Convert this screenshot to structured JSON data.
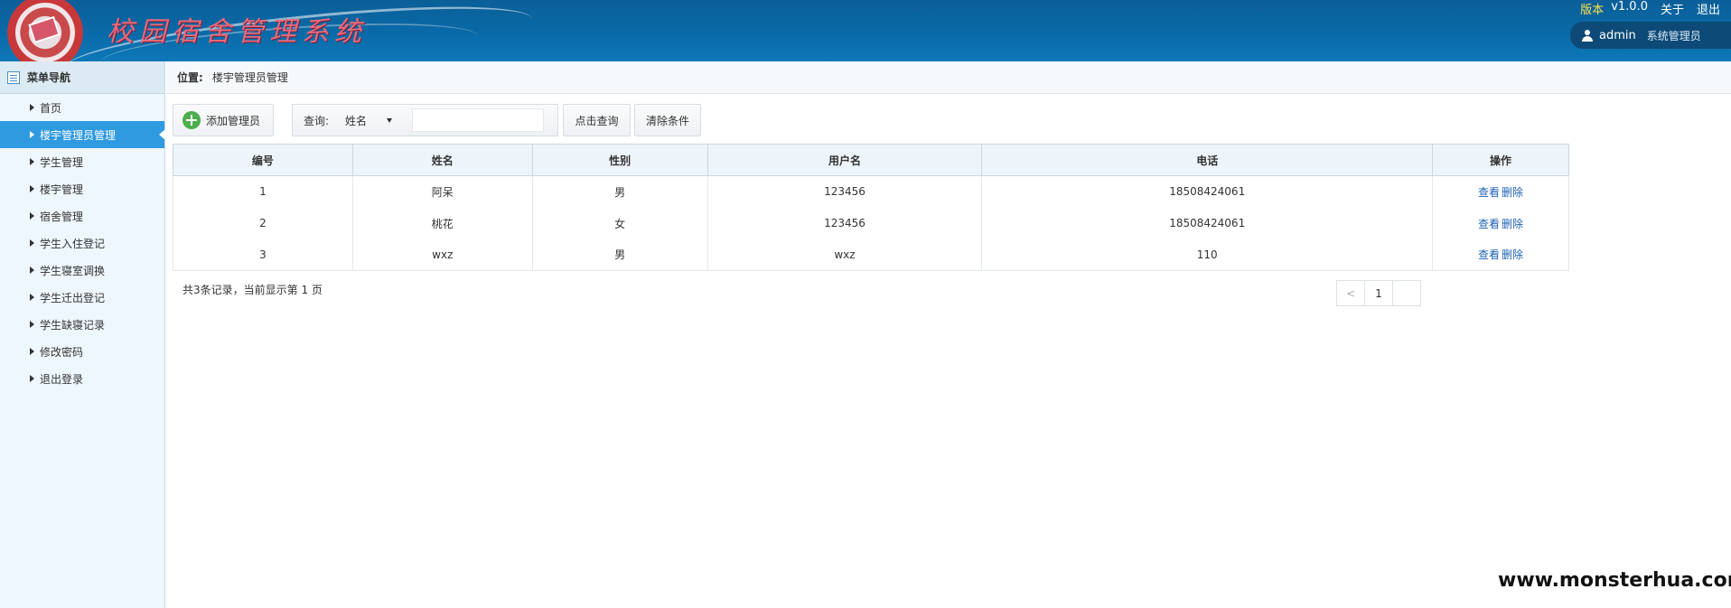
{
  "header": {
    "app_title": "校园宿舍管理系统",
    "version_label": "版本",
    "version": "v1.0.0",
    "about": "关于",
    "logout": "退出",
    "user": "admin",
    "role": "系统管理员"
  },
  "sidebar": {
    "title": "菜单导航",
    "items": [
      {
        "label": "首页",
        "active": false
      },
      {
        "label": "楼宇管理员管理",
        "active": true
      },
      {
        "label": "学生管理",
        "active": false
      },
      {
        "label": "楼宇管理",
        "active": false
      },
      {
        "label": "宿舍管理",
        "active": false
      },
      {
        "label": "学生入住登记",
        "active": false
      },
      {
        "label": "学生寝室调换",
        "active": false
      },
      {
        "label": "学生迁出登记",
        "active": false
      },
      {
        "label": "学生缺寝记录",
        "active": false
      },
      {
        "label": "修改密码",
        "active": false
      },
      {
        "label": "退出登录",
        "active": false
      }
    ]
  },
  "breadcrumb": {
    "label": "位置:",
    "current": "楼宇管理员管理"
  },
  "toolbar": {
    "add_label": "添加管理员",
    "query_label": "查询:",
    "query_field": "姓名",
    "query_value": "",
    "search_label": "点击查询",
    "clear_label": "清除条件"
  },
  "table": {
    "columns": [
      "编号",
      "姓名",
      "性别",
      "用户名",
      "电话",
      "操作"
    ],
    "rows": [
      {
        "id": "1",
        "name": "阿呆",
        "gender": "男",
        "username": "123456",
        "phone": "18508424061",
        "view": "查看",
        "delete": "删除"
      },
      {
        "id": "2",
        "name": "桃花",
        "gender": "女",
        "username": "123456",
        "phone": "18508424061",
        "view": "查看",
        "delete": "删除"
      },
      {
        "id": "3",
        "name": "wxz",
        "gender": "男",
        "username": "wxz",
        "phone": "110",
        "view": "查看",
        "delete": "删除"
      }
    ]
  },
  "summary": "共3条记录，当前显示第 1 页",
  "pager": {
    "prev": "<",
    "current": "1",
    "next": ""
  },
  "watermark": "www.monsterhua.com",
  "colors": {
    "header_bg": "#0a6aa8",
    "active_menu": "#2f9ae0",
    "link": "#1f63b5",
    "version_label": "#ffe14d"
  }
}
